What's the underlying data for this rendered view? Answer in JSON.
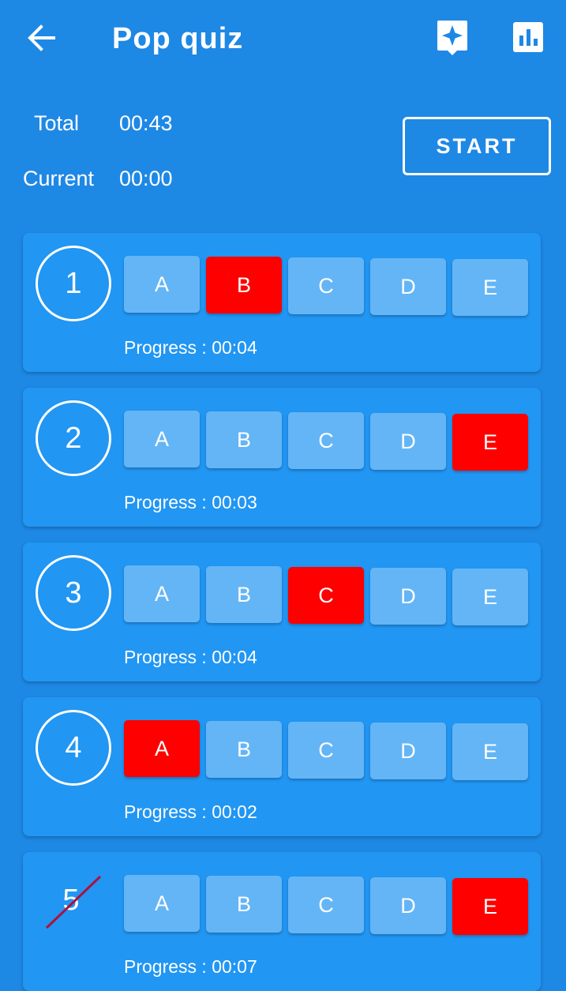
{
  "appbar": {
    "title": "Pop quiz",
    "icons": [
      "back-arrow-icon",
      "rate-star-icon",
      "bar-chart-icon"
    ]
  },
  "timers": {
    "total_label": "Total",
    "total_value": "00:43",
    "current_label": "Current",
    "current_value": "00:00"
  },
  "start_label": "START",
  "colors": {
    "background": "#1E88E5",
    "card": "#2196F3",
    "option": "#64B5F6",
    "selected": "#FF0000"
  },
  "questions": [
    {
      "number": "1",
      "selected": "B",
      "progress": "Progress : 00:04",
      "crossed": false
    },
    {
      "number": "2",
      "selected": "E",
      "progress": "Progress : 00:03",
      "crossed": false
    },
    {
      "number": "3",
      "selected": "C",
      "progress": "Progress : 00:04",
      "crossed": false
    },
    {
      "number": "4",
      "selected": "A",
      "progress": "Progress : 00:02",
      "crossed": false
    },
    {
      "number": "5",
      "selected": "E",
      "progress": "Progress : 00:07",
      "crossed": true
    }
  ],
  "options": [
    "A",
    "B",
    "C",
    "D",
    "E"
  ]
}
